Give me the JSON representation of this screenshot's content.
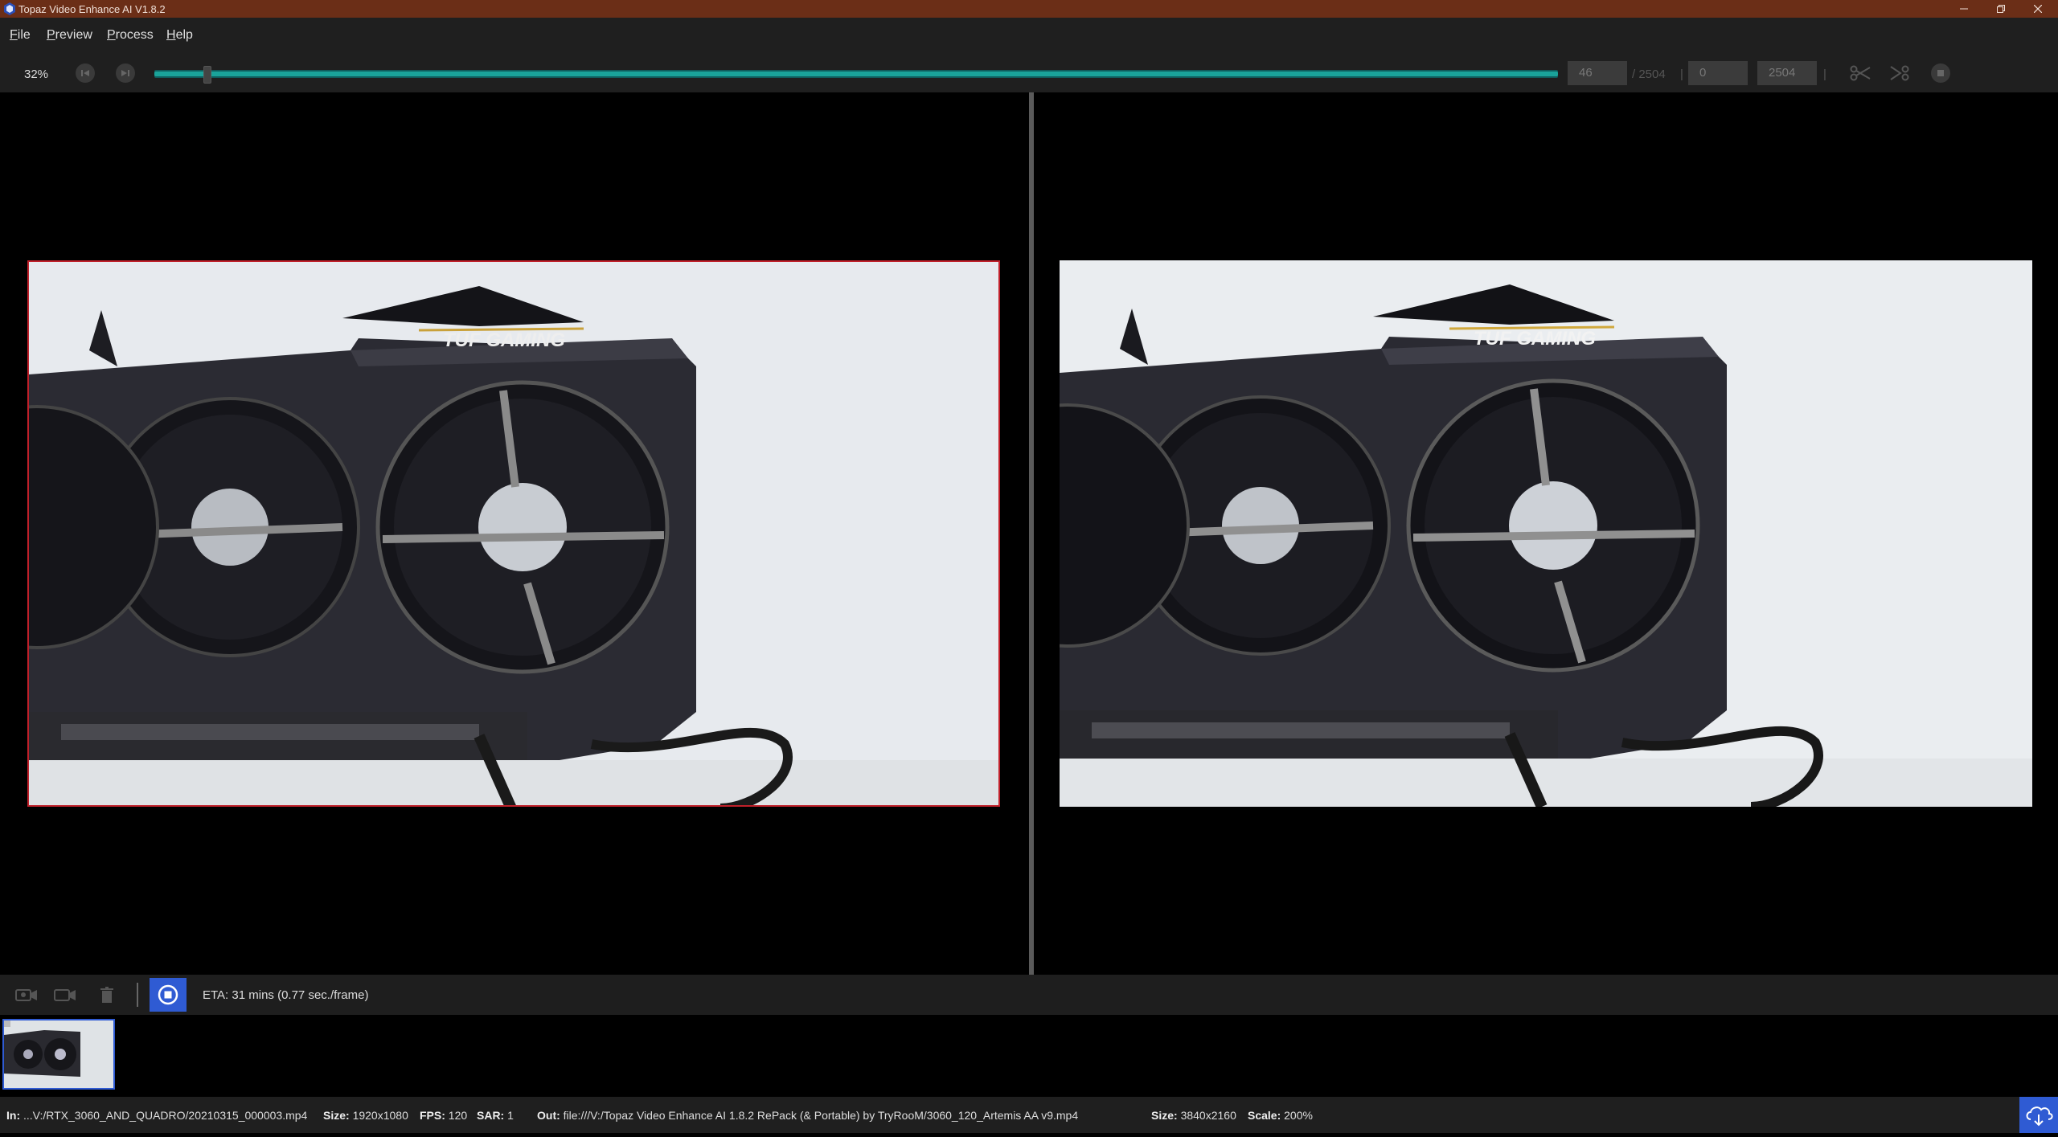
{
  "window": {
    "title": "Topaz Video Enhance AI V1.8.2",
    "controls": [
      "minimize",
      "restore",
      "close"
    ],
    "titlebar_color": "#6b2e17"
  },
  "menu": [
    {
      "label": "File"
    },
    {
      "label": "Preview"
    },
    {
      "label": "Process"
    },
    {
      "label": "Help"
    }
  ],
  "toolbar": {
    "zoom": "32%",
    "progress_fraction": 0.018,
    "current_frame": "46",
    "total_frames": "/ 2504",
    "range_start": "0",
    "range_end": "2504",
    "range_sep_left": "|",
    "range_sep_right": "|",
    "accent_color": "#1aa39a"
  },
  "viewer": {
    "left_frame_border_color": "#c0202a",
    "frame_text": "TUF GAMING"
  },
  "process": {
    "eta": "ETA:  31 mins  (0.77 sec./frame)",
    "stop_button_color": "#2f5bd3"
  },
  "status": {
    "in_label": "In:",
    "in_value": "...V:/RTX_3060_AND_QUADRO/20210315_000003.mp4",
    "size_label": "Size:",
    "size_value": "1920x1080",
    "fps_label": "FPS:",
    "fps_value": "120",
    "sar_label": "SAR:",
    "sar_value": "1",
    "out_label": "Out:",
    "out_value": "file:///V:/Topaz Video Enhance AI 1.8.2 RePack (& Portable) by TryRooM/3060_120_Artemis AA v9.mp4",
    "out_size_label": "Size:",
    "out_size_value": "3840x2160",
    "scale_label": "Scale:",
    "scale_value": "200%"
  }
}
